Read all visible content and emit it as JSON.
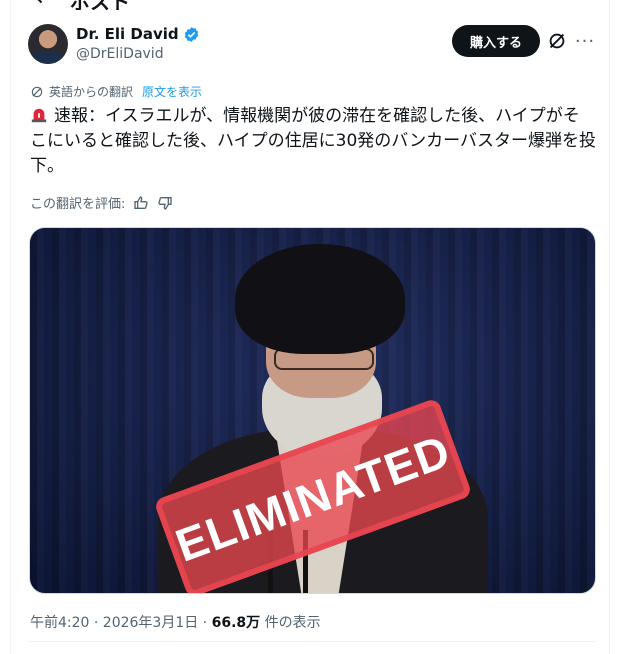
{
  "header": {
    "back_glyph": "←",
    "title": "ポスト"
  },
  "author": {
    "name": "Dr. Eli David",
    "handle": "@DrEliDavid",
    "verified_color": "#1d9bf0"
  },
  "actions": {
    "subscribe_label": "購入する",
    "more_glyph": "···"
  },
  "translation": {
    "label": "英語からの翻訳",
    "show_original": "原文を表示"
  },
  "tweet": {
    "text": "速報：イスラエルが、情報機関が彼の滞在を確認した後、ハイプがそこにいると確認した後、ハイプの住居に30発のバンカーバスター爆弾を投下。"
  },
  "rate": {
    "label": "この翻訳を評価:"
  },
  "media": {
    "stamp_text": "ELIMINATED"
  },
  "meta": {
    "time_date": "午前4:20 · 2026年3月1日 · ",
    "views": "66.8万",
    "views_suffix": " 件の表示"
  },
  "colors": {
    "accent": "#1d9bf0",
    "text": "#0f1419",
    "muted": "#536471",
    "stamp": "#e84650"
  }
}
